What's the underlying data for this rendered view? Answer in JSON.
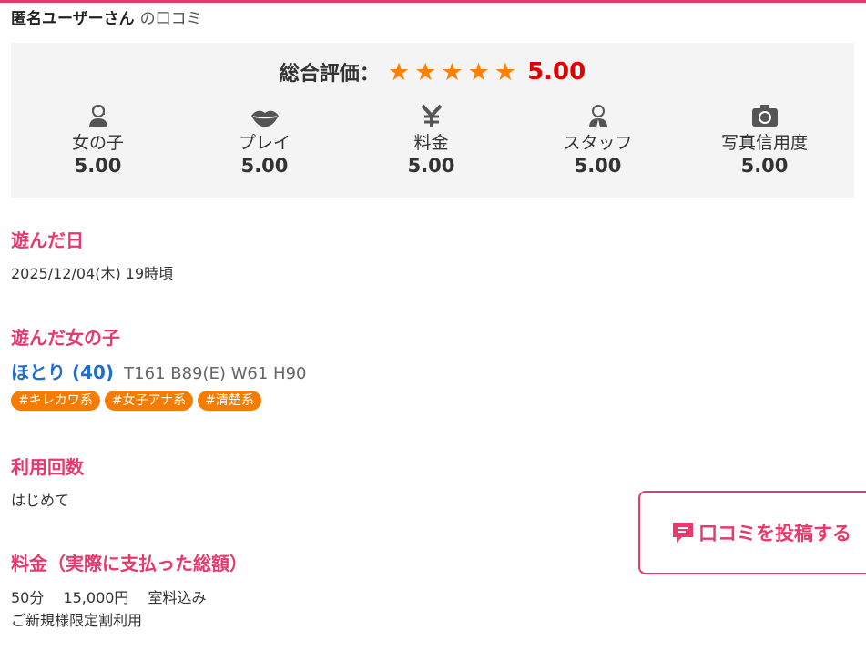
{
  "header": {
    "user_name": "匿名ユーザーさん",
    "suffix": "の口コミ"
  },
  "overall": {
    "label": "総合評価：",
    "stars": 5,
    "score": "5.00"
  },
  "categories": [
    {
      "name": "女の子",
      "value": "5.00",
      "icon": "girl-icon"
    },
    {
      "name": "プレイ",
      "value": "5.00",
      "icon": "lips-icon"
    },
    {
      "name": "料金",
      "value": "5.00",
      "icon": "yen-icon"
    },
    {
      "name": "スタッフ",
      "value": "5.00",
      "icon": "staff-icon"
    },
    {
      "name": "写真信用度",
      "value": "5.00",
      "icon": "camera-icon"
    }
  ],
  "visit_date": {
    "title": "遊んだ日",
    "value": "2025/12/04(木) 19時頃"
  },
  "girl": {
    "title": "遊んだ女の子",
    "name": "ほとり (40)",
    "spec": "T161 B89(E) W61 H90",
    "tags": [
      "#キレカワ系",
      "#女子アナ系",
      "#清楚系"
    ]
  },
  "usage_count": {
    "title": "利用回数",
    "value": "はじめて"
  },
  "price": {
    "title": "料金（実際に支払った総額）",
    "line1": "50分　 15,000円　 室料込み",
    "line2": "ご新規様限定割利用"
  },
  "post_button": {
    "label": "口コミを投稿する"
  },
  "colors": {
    "accent": "#e8386c",
    "star": "#ff7f00",
    "score": "#e00000",
    "link": "#1f6fcf",
    "tag": "#f57c00"
  }
}
